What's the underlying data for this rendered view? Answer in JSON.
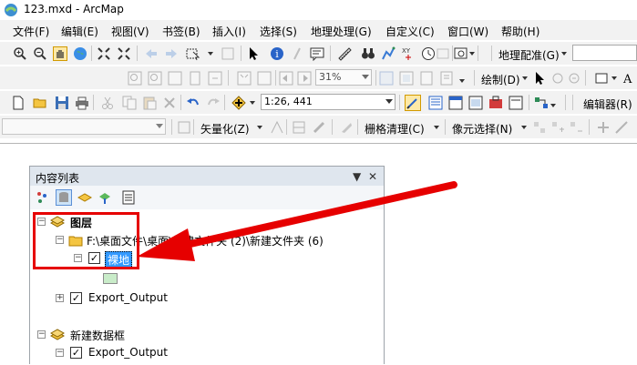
{
  "window": {
    "title": "123.mxd - ArcMap"
  },
  "menu": {
    "items": [
      "文件(F)",
      "编辑(E)",
      "视图(V)",
      "书签(B)",
      "插入(I)",
      "选择(S)",
      "地理处理(G)",
      "自定义(C)",
      "窗口(W)",
      "帮助(H)"
    ]
  },
  "toolbar1": {
    "georef_label": "地理配准(G)"
  },
  "toolbar2": {
    "zoom_value": "31%",
    "draw_label": "绘制(D)"
  },
  "toolbar3": {
    "scale_value": "1:26, 441",
    "editor_label": "编辑器(R)"
  },
  "toolbar4": {
    "vectorize_label": "矢量化(Z)",
    "raster_cleanup_label": "栅格清理(C)",
    "cell_select_label": "像元选择(N)"
  },
  "toc": {
    "title": "内容列表",
    "pin": "▼",
    "close": "✕",
    "dataframe1": "图层",
    "folder": "F:\\桌面文件\\桌面\\新建文件夹 (2)\\新建文件夹 (6)",
    "layer_selected": "裸地",
    "layer_export1": "Export_Output",
    "dataframe2": "新建数据框",
    "layer_export2": "Export_Output"
  },
  "colors": {
    "annotation_red": "#e60000",
    "selection_blue": "#3399ff",
    "swatch_green": "#c9ecc9"
  }
}
